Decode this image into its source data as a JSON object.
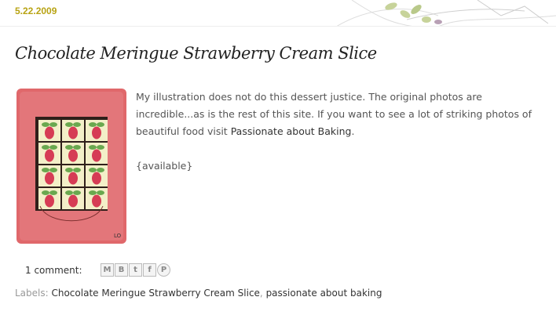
{
  "post": {
    "date": "5.22.2009",
    "title": "Chocolate Meringue Strawberry Cream Slice",
    "paragraph1": "My illustration does not do this dessert justice. The original photos are incredible...as is the rest of this site. If you want to see a lot of striking photos of beautiful food visit ",
    "paragraph1_link": "Passionate about Baking",
    "paragraph1_end": ".",
    "paragraph2": "{available}",
    "signature": "LO"
  },
  "footer": {
    "comment_link": "1 comment:",
    "share_buttons": [
      {
        "label": "M",
        "icon": "email-icon"
      },
      {
        "label": "B",
        "icon": "blogger-icon"
      },
      {
        "label": "t",
        "icon": "twitter-icon"
      },
      {
        "label": "f",
        "icon": "facebook-icon"
      },
      {
        "label": "P",
        "icon": "pinterest-icon"
      }
    ],
    "labels_prefix": "Labels: ",
    "labels": [
      "Chocolate Meringue Strawberry Cream Slice",
      "passionate about baking"
    ],
    "labels_separator": ", "
  },
  "colors": {
    "date": "#b8a313",
    "painting_background": "#e0686b",
    "strawberry": "#d63c55",
    "leaf": "#6aa84f"
  }
}
